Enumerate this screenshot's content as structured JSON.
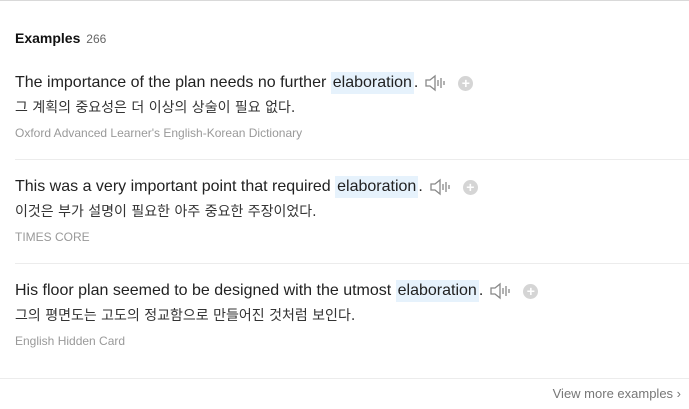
{
  "section": {
    "title": "Examples",
    "count": "266"
  },
  "examples": [
    {
      "before": "The importance of the plan needs no further ",
      "highlight": "elaboration",
      "after": ".",
      "translation": "그 계획의 중요성은 더 이상의 상술이 필요 없다.",
      "source": "Oxford Advanced Learner's English-Korean Dictionary"
    },
    {
      "before": "This was a very important point that required ",
      "highlight": "elaboration",
      "after": ".",
      "translation": "이것은 부가 설명이 필요한 아주 중요한 주장이었다.",
      "source": "TIMES CORE"
    },
    {
      "before": "His floor plan seemed to be designed with the utmost ",
      "highlight": "elaboration",
      "after": ".",
      "translation": "그의 평면도는 고도의 정교함으로 만들어진 것처럼 보인다.",
      "source": "English Hidden Card"
    }
  ],
  "plus_glyph": "+",
  "view_more": "View more examples ›",
  "icons": {
    "speaker": "speaker-icon",
    "add": "add-icon"
  },
  "colors": {
    "highlight": "#e6f2fc",
    "source_text": "#999999"
  }
}
